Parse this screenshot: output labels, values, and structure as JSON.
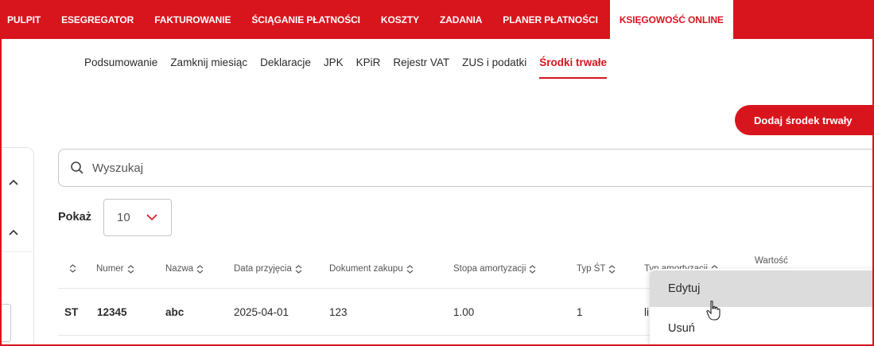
{
  "topnav": {
    "items": [
      "PULPIT",
      "ESEGREGATOR",
      "FAKTUROWANIE",
      "ŚCIĄGANIE PŁATNOŚCI",
      "KOSZTY",
      "ZADANIA",
      "PLANER PŁATNOŚCI"
    ],
    "active": "KSIĘGOWOŚĆ ONLINE"
  },
  "subnav": {
    "items": [
      "Podsumowanie",
      "Zamknij miesiąc",
      "Deklaracje",
      "JPK",
      "KPiR",
      "Rejestr VAT",
      "ZUS i podatki"
    ],
    "active": "Środki trwałe"
  },
  "add_button": "Dodaj środek trwały",
  "search": {
    "placeholder": "Wyszukaj"
  },
  "show": {
    "label": "Pokaż",
    "value": "10"
  },
  "table": {
    "columns": [
      "Numer",
      "Nazwa",
      "Data przyjęcia",
      "Dokument zakupu",
      "Stopa amortyzacji",
      "Typ ŚT",
      "Typ amortyzacji",
      "Wartość"
    ],
    "row": [
      "ST",
      "12345",
      "abc",
      "2025-04-01",
      "123",
      "1.00",
      "1",
      "li"
    ]
  },
  "context_menu": [
    "Edytuj",
    "Usuń"
  ],
  "colors": {
    "brand": "#d8141d",
    "hover": "#dcdcdc"
  },
  "icons": [
    "search-icon",
    "chevron-up-icon",
    "chevron-down-icon",
    "sort-icon",
    "pointer-cursor-icon"
  ]
}
